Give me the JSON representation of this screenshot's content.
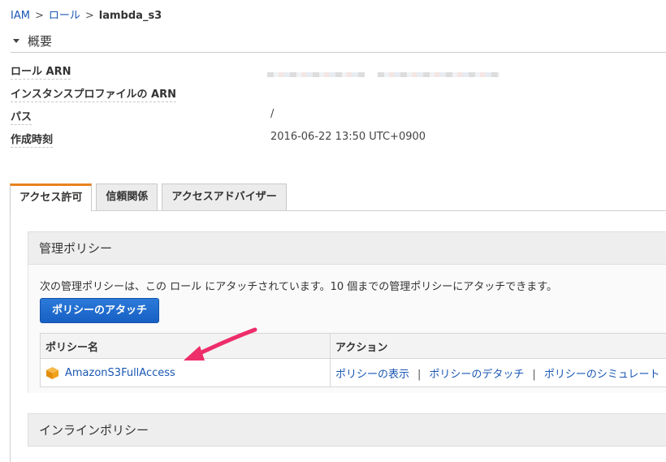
{
  "breadcrumb": {
    "root": "IAM",
    "roles": "ロール",
    "current": "lambda_s3",
    "separator": ">"
  },
  "summary": {
    "title": "概要",
    "rows": [
      {
        "label": "ロール ARN",
        "value": ""
      },
      {
        "label": "インスタンスプロファイルの ARN",
        "value": ""
      },
      {
        "label": "パス",
        "value": "/"
      },
      {
        "label": "作成時刻",
        "value": "2016-06-22 13:50 UTC+0900"
      }
    ]
  },
  "tabs": [
    {
      "label": "アクセス許可",
      "active": true
    },
    {
      "label": "信頼関係",
      "active": false
    },
    {
      "label": "アクセスアドバイザー",
      "active": false
    }
  ],
  "managed_policies": {
    "title": "管理ポリシー",
    "description": "次の管理ポリシーは、この ロール にアタッチされています。10 個までの管理ポリシーにアタッチできます。",
    "attach_button": "ポリシーのアタッチ",
    "table": {
      "headers": [
        "ポリシー名",
        "アクション"
      ],
      "rows": [
        {
          "policy_name": "AmazonS3FullAccess",
          "icon": "aws-cube-icon",
          "actions": [
            "ポリシーの表示",
            "ポリシーのデタッチ",
            "ポリシーのシミュレート"
          ]
        }
      ],
      "action_separator": "|"
    }
  },
  "inline_policies": {
    "title": "インラインポリシー"
  },
  "colors": {
    "link": "#1a57b3",
    "button": "#1e6acc",
    "active_tab_accent": "#e7821e",
    "annotation_arrow": "#ee2d6b",
    "policy_icon": "#f0a21d"
  }
}
